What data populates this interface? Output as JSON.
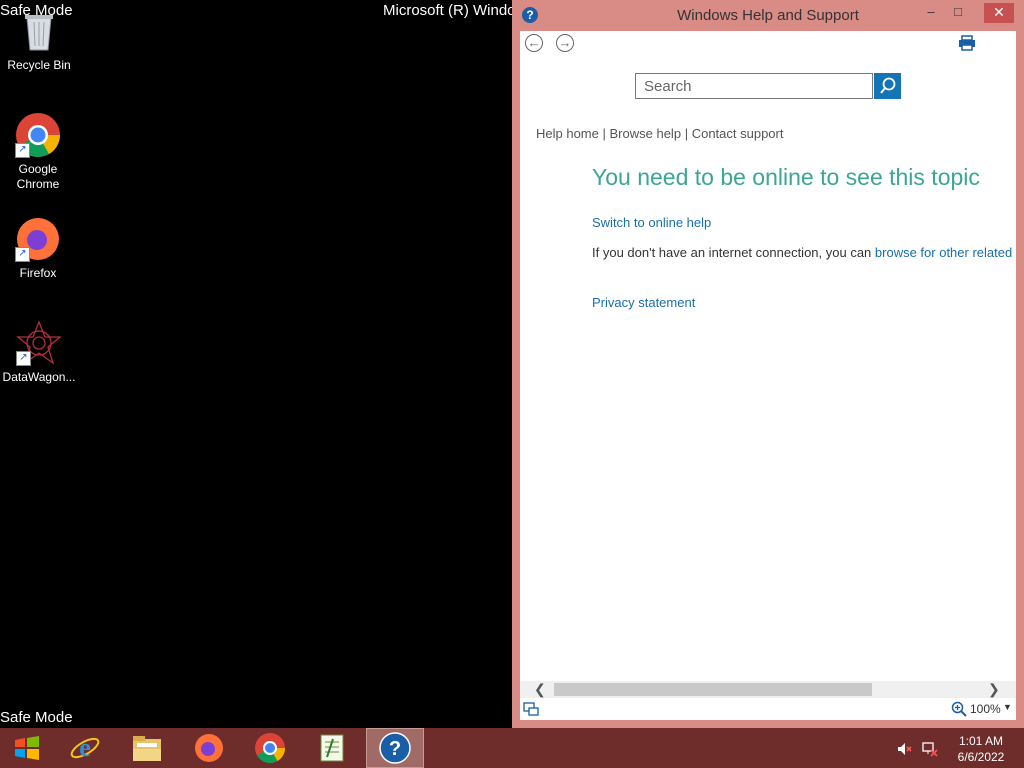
{
  "desktop": {
    "safe_mode_top": "Safe Mode",
    "safe_mode_bottom": "Safe Mode",
    "os_title": "Microsoft (R) Windo",
    "icons": [
      {
        "label": "Recycle Bin",
        "icon": "recycle-bin-icon"
      },
      {
        "label": "Google Chrome",
        "icon": "chrome-icon"
      },
      {
        "label": "Firefox",
        "icon": "firefox-icon"
      },
      {
        "label": "DataWagon...",
        "icon": "datawagon-icon"
      }
    ]
  },
  "help_window": {
    "title": "Windows Help and Support",
    "buttons": {
      "minimize": "–",
      "maximize": "□",
      "close": "✕"
    },
    "search": {
      "placeholder": "Search",
      "value": ""
    },
    "breadcrumb": {
      "help_home": "Help home",
      "browse_help": "Browse help",
      "contact_support": "Contact support",
      "separator": "|"
    },
    "heading": "You need to be online to see this topic",
    "switch_online": "Switch to online help",
    "offline_note_prefix": "If you don't have an internet connection, you can ",
    "offline_note_link": "browse for other related",
    "privacy": "Privacy statement",
    "zoom": "100%"
  },
  "taskbar": {
    "apps": [
      "start-icon",
      "internet-explorer-icon",
      "file-explorer-icon",
      "firefox-icon",
      "chrome-icon",
      "notepad-icon",
      "help-icon"
    ],
    "clock_time": "1:01 AM",
    "clock_date": "6/6/2022"
  },
  "colors": {
    "window_frame": "#d98b86",
    "taskbar": "#6e2c2a",
    "heading": "#3aa796",
    "link": "#1a6fa8",
    "search_button": "#1475b4"
  }
}
